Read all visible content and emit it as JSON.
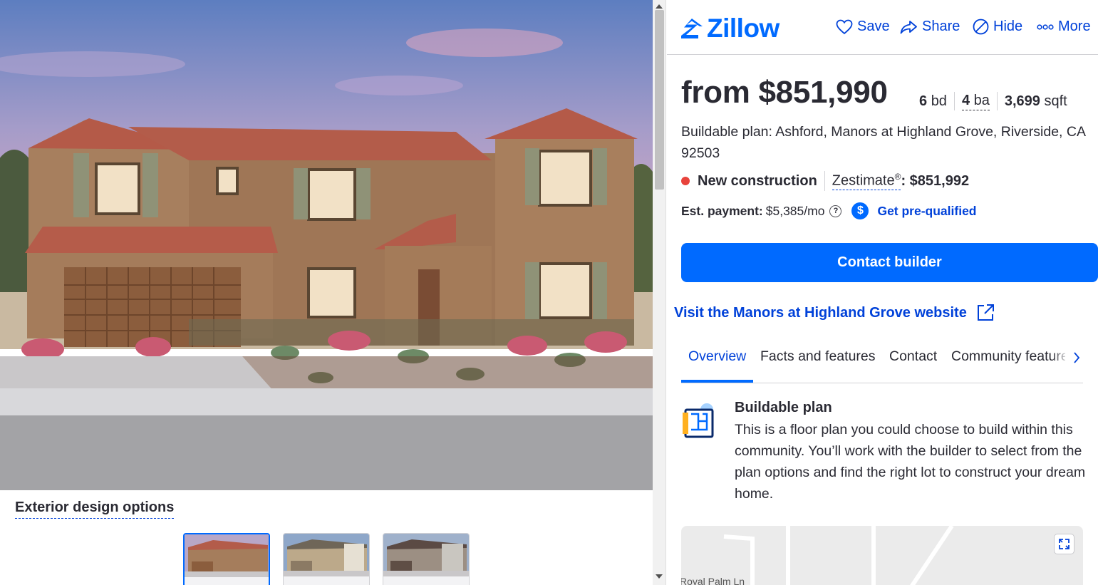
{
  "header": {
    "logo_text": "Zillow",
    "actions": [
      {
        "label": "Save",
        "icon": "heart-icon"
      },
      {
        "label": "Share",
        "icon": "share-icon"
      },
      {
        "label": "Hide",
        "icon": "hide-icon"
      },
      {
        "label": "More",
        "icon": "more-icon"
      }
    ]
  },
  "listing": {
    "price": "from $851,990",
    "beds_value": "6",
    "beds_unit": "bd",
    "baths_value": "4",
    "baths_unit": "ba",
    "sqft_value": "3,699",
    "sqft_unit": "sqft",
    "address": "Buildable plan: Ashford, Manors at Highland Grove, Riverside, CA 92503",
    "status": "New construction",
    "zestimate_label": "Zestimate",
    "zestimate_sup": "®",
    "zestimate_value": ": $851,992",
    "payment_label": "Est. payment:",
    "payment_value": "$5,385/mo",
    "payment_help": "?",
    "prequal_symbol": "$",
    "prequal_label": "Get pre-qualified",
    "contact_button": "Contact builder",
    "visit_link": "Visit the Manors at Highland Grove website"
  },
  "tabs": [
    {
      "label": "Overview",
      "active": true
    },
    {
      "label": "Facts and features",
      "active": false
    },
    {
      "label": "Contact",
      "active": false
    },
    {
      "label": "Community features",
      "active": false
    }
  ],
  "overview": {
    "title": "Buildable plan",
    "description": "This is a floor plan you could choose to build within this community. You’ll work with the builder to select from the plan options and find the right lot to construct your dream home."
  },
  "map": {
    "street_label": "Royal Palm Ln"
  },
  "gallery": {
    "exterior_title": "Exterior design options",
    "selected_thumb": 1
  },
  "colors": {
    "brand_blue": "#006aff",
    "link_blue": "#0041d9",
    "status_red": "#e8433c",
    "text_dark": "#2a2a33"
  }
}
